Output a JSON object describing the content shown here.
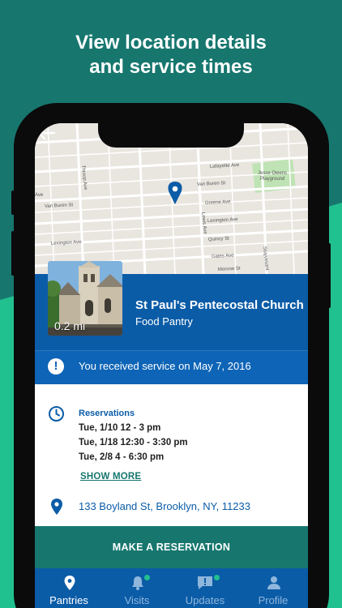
{
  "headline": {
    "line1": "View location details",
    "line2": "and service times"
  },
  "map": {
    "streets": [
      "Kosciuszko St",
      "Lafayette Ave",
      "Throop Ave",
      "Van Buren St",
      "Greene Ave",
      "Jesse Owens Playground",
      "Lexington Ave",
      "Quincy St",
      "Gates Ave",
      "Lewis Ave",
      "Stuyvesant",
      "Monroe St",
      "Ave"
    ]
  },
  "place": {
    "name": "St Paul's Pentecostal Church",
    "type": "Food Pantry",
    "distance": "0.2 mi"
  },
  "service_banner": {
    "icon": "exclamation-icon",
    "text": "You received service on May 7, 2016"
  },
  "reservations": {
    "title": "Reservations",
    "times": [
      "Tue, 1/10 12 - 3 pm",
      "Tue, 1/18 12:30 - 3:30 pm",
      "Tue, 2/8 4 - 6:30 pm"
    ],
    "show_more": "SHOW MORE"
  },
  "address": "133 Boyland St, Brooklyn, NY, 11233",
  "cta_label": "MAKE A RESERVATION",
  "nav": {
    "items": [
      {
        "label": "Pantries",
        "icon": "location-pin-icon",
        "active": true
      },
      {
        "label": "Visits",
        "icon": "bell-icon",
        "active": false
      },
      {
        "label": "Updates",
        "icon": "message-alert-icon",
        "active": false
      },
      {
        "label": "Profile",
        "icon": "person-icon",
        "active": false
      }
    ]
  },
  "colors": {
    "teal_dark": "#17776f",
    "teal_light": "#21c08f",
    "blue": "#0b5ca7",
    "blue_banner": "#0e64b6",
    "map_bg": "#e9e6df",
    "park": "#bfe3b4",
    "nav_inactive": "#8fb6db"
  }
}
